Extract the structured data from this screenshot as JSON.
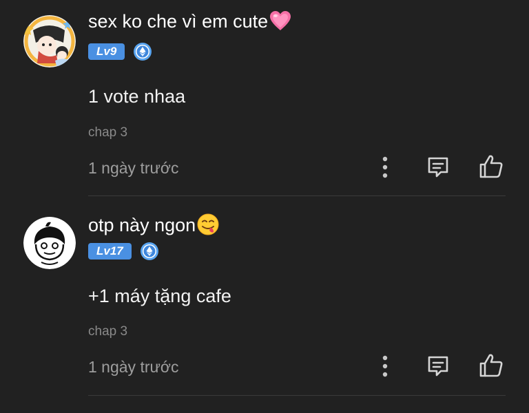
{
  "comments": [
    {
      "username": "sex ko che vì em cute",
      "username_emoji": "pink-heart",
      "level": "Lv9",
      "verified_icon": "ethereum-badge-icon",
      "content": "1 vote nhaa",
      "chapter": "chap 3",
      "time": "1 ngày trước"
    },
    {
      "username": "otp này ngon",
      "username_emoji": "yum-face",
      "level": "Lv17",
      "verified_icon": "ethereum-badge-icon",
      "content": "+1 máy tặng cafe",
      "chapter": "chap 3",
      "time": "1 ngày trước"
    }
  ],
  "colors": {
    "background": "#212121",
    "level_badge": "#4a90e2",
    "muted_text": "#9e9e9e",
    "divider": "#3a3a3a"
  }
}
